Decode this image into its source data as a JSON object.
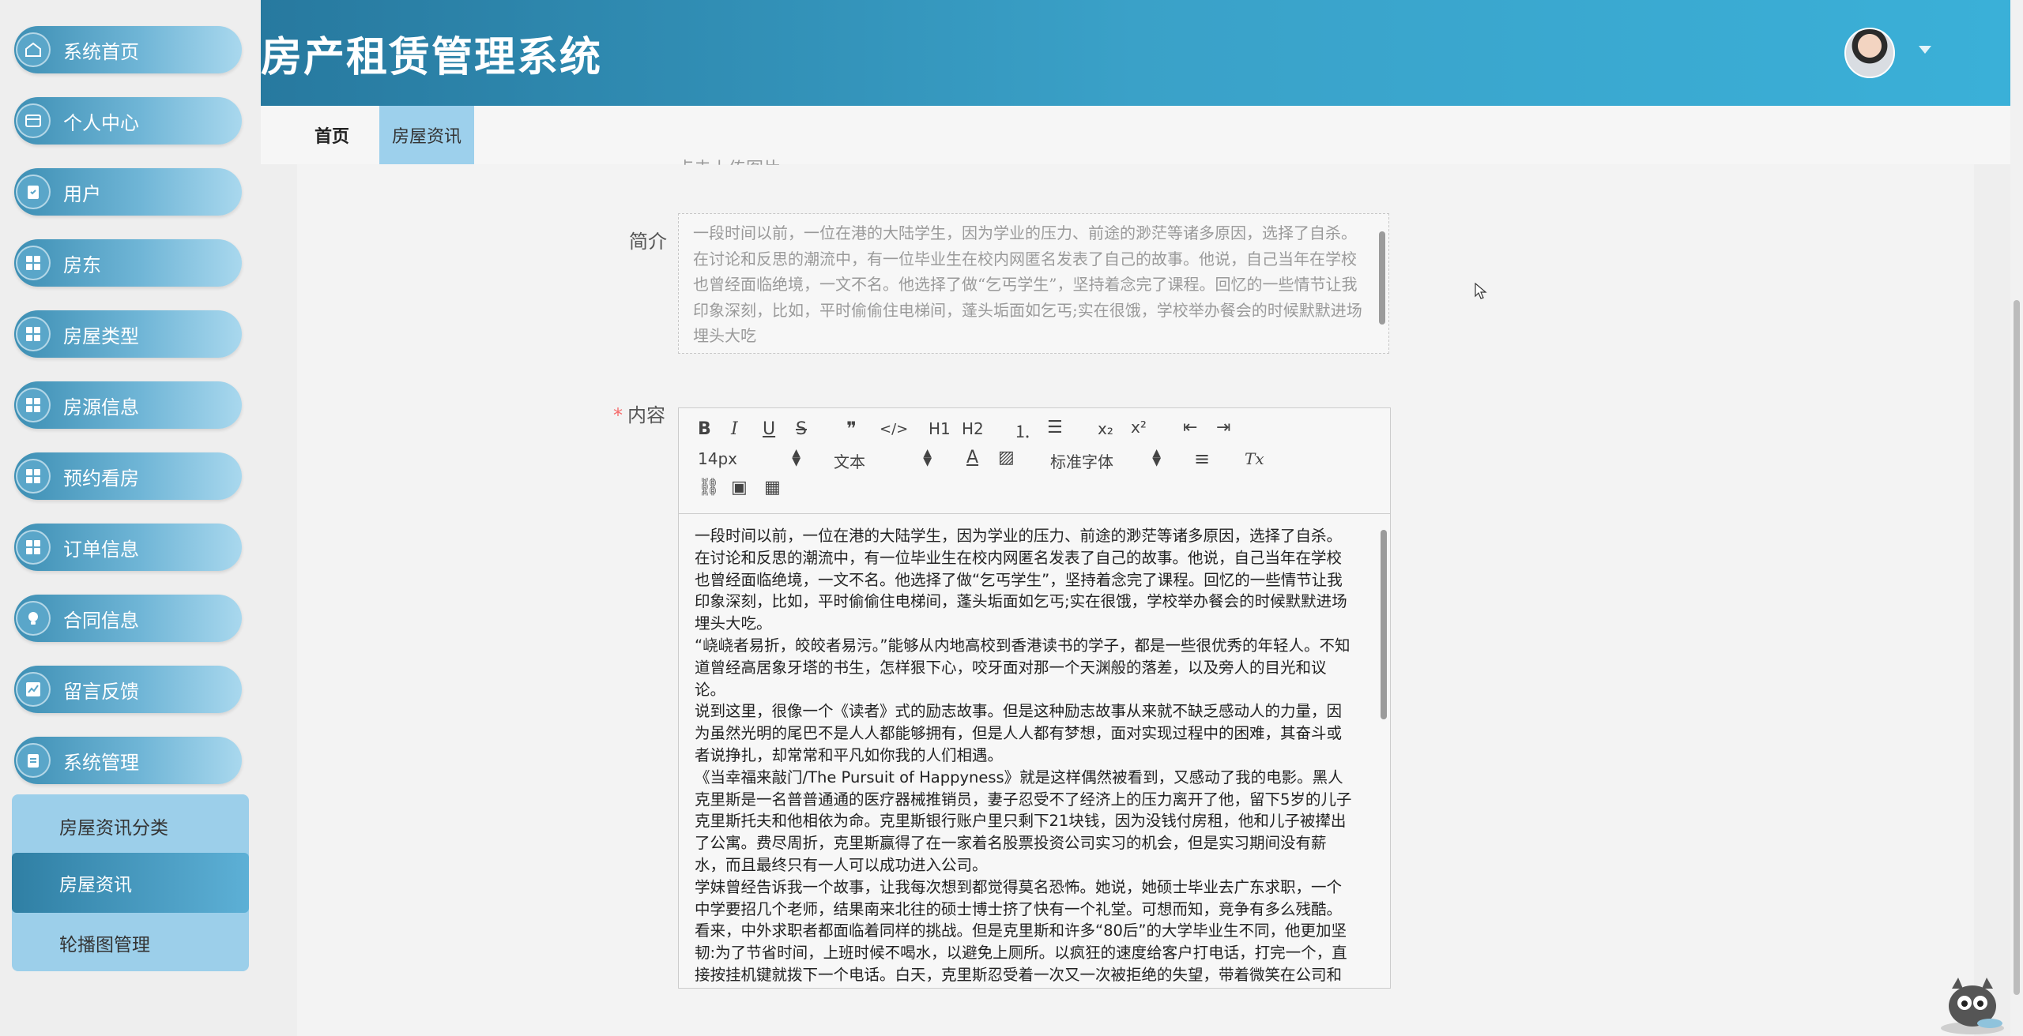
{
  "sidebar": {
    "items": [
      {
        "label": "系统首页",
        "icon": "home-icon"
      },
      {
        "label": "个人中心",
        "icon": "card-icon"
      },
      {
        "label": "用户",
        "icon": "clipboard-icon"
      },
      {
        "label": "房东",
        "icon": "grid-icon"
      },
      {
        "label": "房屋类型",
        "icon": "grid-icon"
      },
      {
        "label": "房源信息",
        "icon": "grid-icon"
      },
      {
        "label": "预约看房",
        "icon": "grid-icon"
      },
      {
        "label": "订单信息",
        "icon": "grid-icon"
      },
      {
        "label": "合同信息",
        "icon": "bulb-icon"
      },
      {
        "label": "留言反馈",
        "icon": "chart-icon"
      },
      {
        "label": "系统管理",
        "icon": "clipboard-icon"
      }
    ],
    "submenu": [
      {
        "label": "房屋资讯分类"
      },
      {
        "label": "房屋资讯"
      },
      {
        "label": "轮播图管理"
      }
    ]
  },
  "header": {
    "title": "房产租赁管理系统"
  },
  "tabs": [
    {
      "label": "首页"
    },
    {
      "label": "房屋资讯"
    }
  ],
  "form": {
    "cut_text": "点击上传图片",
    "intro_label": "简介",
    "intro_text": "一段时间以前，一位在港的大陆学生，因为学业的压力、前途的渺茫等诸多原因，选择了自杀。在讨论和反思的潮流中，有一位毕业生在校内网匿名发表了自己的故事。他说，自己当年在学校也曾经面临绝境，一文不名。他选择了做“乞丐学生”，坚持着念完了课程。回忆的一些情节让我印象深刻，比如，平时偷偷住电梯间，蓬头垢面如乞丐;实在很饿，学校举办餐会的时候默默进场埋头大吃",
    "content_label": "内容",
    "required_mark": "*"
  },
  "toolbar": {
    "bold": "B",
    "italic": "I",
    "underline": "U",
    "strike": "S",
    "quote": "❞",
    "code": "</>",
    "h1": "H1",
    "h2": "H2",
    "ol": "⒈",
    "ul": "☰",
    "sub": "x₂",
    "sup": "x²",
    "outdent": "⇤",
    "indent": "⇥",
    "size_value": "14px",
    "type_value": "文本",
    "color": "A",
    "bg": "▨",
    "font_value": "标准字体",
    "align": "≡",
    "clean": "Tx",
    "link": "⛓",
    "image": "▣",
    "video": "▦"
  },
  "editor": {
    "paragraphs": [
      "一段时间以前，一位在港的大陆学生，因为学业的压力、前途的渺茫等诸多原因，选择了自杀。在讨论和反思的潮流中，有一位毕业生在校内网匿名发表了自己的故事。他说，自己当年在学校也曾经面临绝境，一文不名。他选择了做“乞丐学生”，坚持着念完了课程。回忆的一些情节让我印象深刻，比如，平时偷偷住电梯间，蓬头垢面如乞丐;实在很饿，学校举办餐会的时候默默进场埋头大吃。",
      "“峣峣者易折，皎皎者易污。”能够从内地高校到香港读书的学子，都是一些很优秀的年轻人。不知道曾经高居象牙塔的书生，怎样狠下心，咬牙面对那一个天渊般的落差，以及旁人的目光和议论。",
      "说到这里，很像一个《读者》式的励志故事。但是这种励志故事从来就不缺乏感动人的力量，因为虽然光明的尾巴不是人人都能够拥有，但是人人都有梦想，面对实现过程中的困难，其奋斗或者说挣扎，却常常和平凡如你我的人们相遇。",
      "《当幸福来敲门/The Pursuit of Happyness》就是这样偶然被看到，又感动了我的电影。黑人克里斯是一名普普通通的医疗器械推销员，妻子忍受不了经济上的压力离开了他，留下5岁的儿子克里斯托夫和他相依为命。克里斯银行账户里只剩下21块钱，因为没钱付房租，他和儿子被撵出了公寓。费尽周折，克里斯赢得了在一家着名股票投资公司实习的机会，但是实习期间没有薪水，而且最终只有一人可以成功进入公司。",
      "学妹曾经告诉我一个故事，让我每次想到都觉得莫名恐怖。她说，她硕士毕业去广东求职，一个中学要招几个老师，结果南来北往的硕士博士挤了快有一个礼堂。可想而知，竞争有多么残酷。看来，中外求职者都面临着同样的挑战。但是克里斯和许多“80后”的大学毕业生不同，他更加坚韧:为了节省时间，上班时候不喝水，以避免上厕所。以疯狂的速度给客户打电话，打完一个，直接按挂机键就拨下一个电话。白天，克里斯忍受着一次又一次被拒绝的失望，带着微笑在公司和"
    ]
  },
  "colors": {
    "accent": "#3aa1c8",
    "nav_gradient_start": "#3d8fb4",
    "submenu_bg": "#9ccfea",
    "required": "#f56c6c"
  }
}
